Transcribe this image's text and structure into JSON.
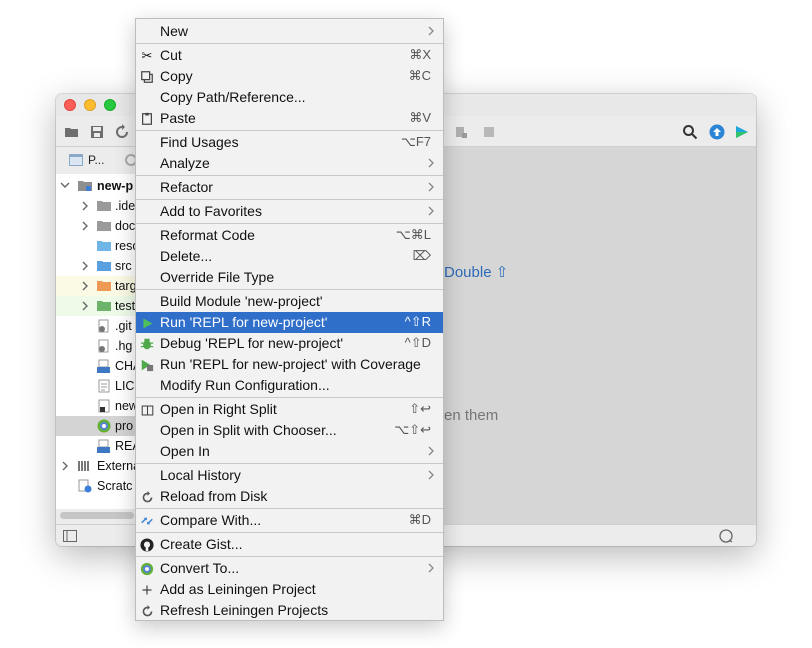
{
  "colors": {
    "menu_highlight": "#2f6fca",
    "window_bg": "#ececec",
    "editor_bg": "#d6d6d6",
    "link_blue": "#2e6ab8"
  },
  "project_panel": {
    "header_label": "P...",
    "items": [
      {
        "label": "new-p",
        "icon": "project-folder-icon",
        "bold": true
      },
      {
        "label": ".ide",
        "icon": "folder-icon"
      },
      {
        "label": "doc",
        "icon": "folder-icon"
      },
      {
        "label": "reso",
        "icon": "resources-folder-icon"
      },
      {
        "label": "src",
        "icon": "source-folder-icon"
      },
      {
        "label": "targ",
        "icon": "excluded-folder-icon"
      },
      {
        "label": "test",
        "icon": "test-folder-icon"
      },
      {
        "label": ".git",
        "icon": "ignore-file-icon"
      },
      {
        "label": ".hg",
        "icon": "ignore-file-icon"
      },
      {
        "label": "CHA",
        "icon": "markdown-file-icon"
      },
      {
        "label": "LIC",
        "icon": "text-file-icon"
      },
      {
        "label": "new",
        "icon": "file-icon"
      },
      {
        "label": "pro",
        "icon": "clojure-file-icon"
      },
      {
        "label": "REA",
        "icon": "markdown-file-icon"
      },
      {
        "label": "Externa",
        "icon": "external-libraries-icon"
      },
      {
        "label": "Scratc",
        "icon": "scratches-icon"
      }
    ]
  },
  "editor": {
    "hint_double": "Double ⇧",
    "hint_open": "en them"
  },
  "context_menu": {
    "items": [
      {
        "label": "New",
        "submenu": true
      },
      {
        "label": "Cut",
        "shortcut": "⌘X",
        "icon": "scissors-icon"
      },
      {
        "label": "Copy",
        "shortcut": "⌘C",
        "icon": "copy-icon"
      },
      {
        "label": "Copy Path/Reference..."
      },
      {
        "label": "Paste",
        "shortcut": "⌘V",
        "icon": "clipboard-icon"
      },
      {
        "label": "Find Usages",
        "shortcut": "⌥F7"
      },
      {
        "label": "Analyze",
        "submenu": true
      },
      {
        "label": "Refactor",
        "submenu": true
      },
      {
        "label": "Add to Favorites",
        "submenu": true
      },
      {
        "label": "Reformat Code",
        "shortcut": "⌥⌘L"
      },
      {
        "label": "Delete...",
        "shortcut": "⌦"
      },
      {
        "label": "Override File Type"
      },
      {
        "label": "Build Module 'new-project'"
      },
      {
        "label": "Run 'REPL for new-project'",
        "shortcut": "^⇧R",
        "icon": "run-icon",
        "highlighted": true
      },
      {
        "label": "Debug 'REPL for new-project'",
        "shortcut": "^⇧D",
        "icon": "debug-bug-icon"
      },
      {
        "label": "Run 'REPL for new-project' with Coverage",
        "icon": "coverage-icon"
      },
      {
        "label": "Modify Run Configuration..."
      },
      {
        "label": "Open in Right Split",
        "shortcut": "⇧↩",
        "icon": "split-icon"
      },
      {
        "label": "Open in Split with Chooser...",
        "shortcut": "⌥⇧↩"
      },
      {
        "label": "Open In",
        "submenu": true
      },
      {
        "label": "Local History",
        "submenu": true
      },
      {
        "label": "Reload from Disk",
        "icon": "reload-icon"
      },
      {
        "label": "Compare With...",
        "shortcut": "⌘D",
        "icon": "compare-icon"
      },
      {
        "label": "Create Gist...",
        "icon": "github-icon"
      },
      {
        "label": "Convert To...",
        "submenu": true,
        "icon": "clojure-icon"
      },
      {
        "label": "Add as Leiningen Project",
        "icon": "plus-icon"
      },
      {
        "label": "Refresh Leiningen Projects",
        "icon": "refresh-icon"
      }
    ]
  }
}
